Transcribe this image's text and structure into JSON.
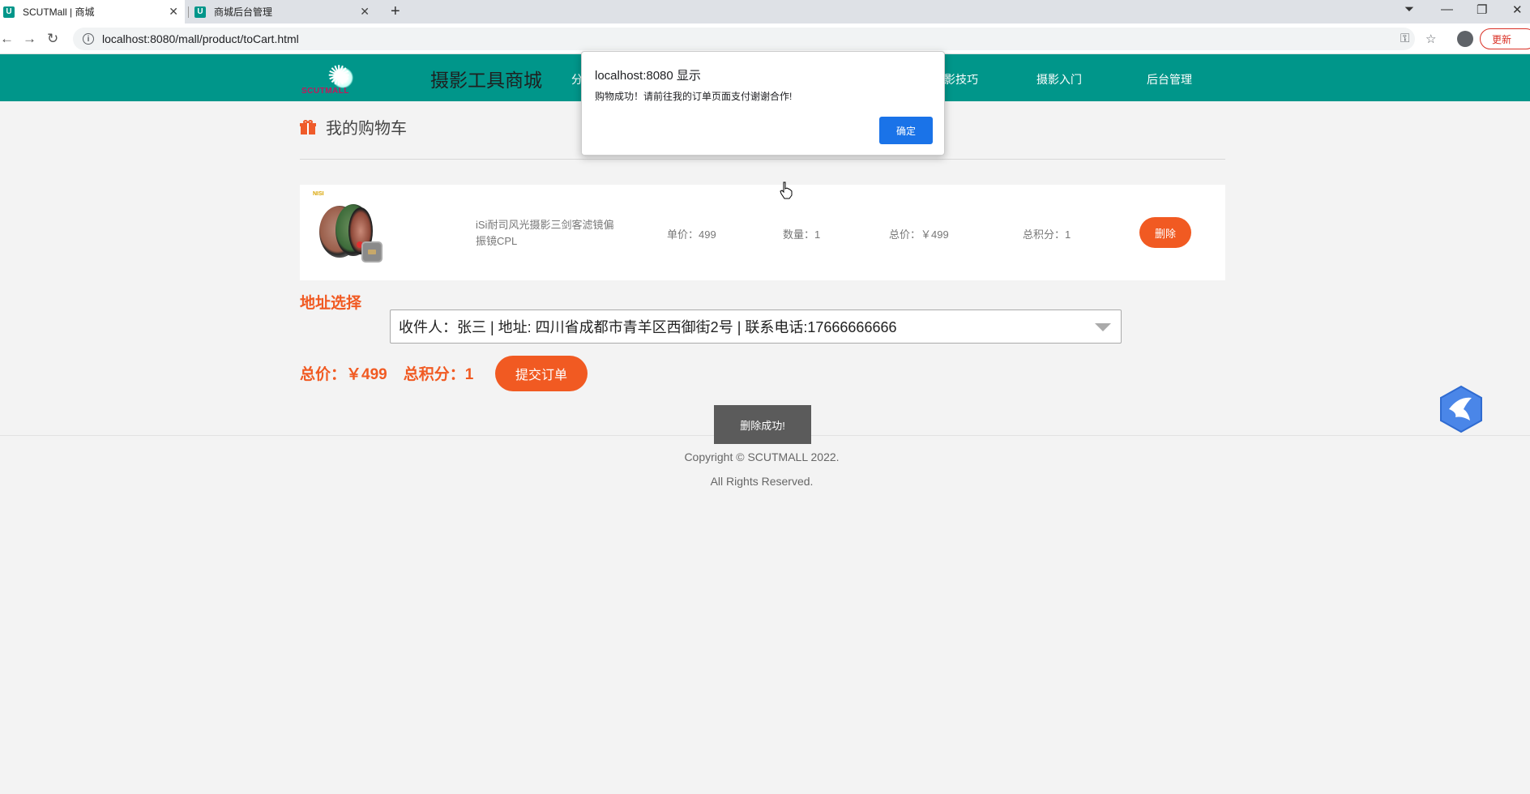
{
  "browser": {
    "tabs": [
      {
        "title": "SCUTMall | 商城",
        "active": true
      },
      {
        "title": "商城后台管理",
        "active": false
      }
    ],
    "url": "localhost:8080/mall/product/toCart.html",
    "update_label": "更新"
  },
  "header": {
    "logo_word": "SCUTMALL",
    "site_title": "摄影工具商城",
    "nav": [
      "分",
      "影技巧",
      "摄影入门",
      "后台管理"
    ]
  },
  "cart": {
    "title": "我的购物车",
    "items": [
      {
        "brand": "NISI",
        "name": "iSi耐司风光摄影三剑客滤镜偏振镜CPL",
        "unit_price": "单价：499",
        "quantity": "数量：1",
        "total": "总价：￥499",
        "points": "总积分：1",
        "delete_label": "删除"
      }
    ]
  },
  "address": {
    "label": "地址选择",
    "selected": "收件人：张三 | 地址: 四川省成都市青羊区西御街2号 | 联系电话:17666666666"
  },
  "summary": {
    "total": "总价：￥499",
    "points": "总积分：1",
    "submit_label": "提交订单"
  },
  "toast": "删除成功!",
  "footer": {
    "copyright": "Copyright © SCUTMALL 2022.",
    "rights": "All Rights Reserved."
  },
  "dialog": {
    "title": "localhost:8080 显示",
    "message": "购物成功！请前往我的订单页面支付谢谢合作!",
    "ok_label": "确定"
  },
  "colors": {
    "header_bg": "#00968a",
    "accent": "#f15a22",
    "dialog_button": "#1a73e8"
  }
}
